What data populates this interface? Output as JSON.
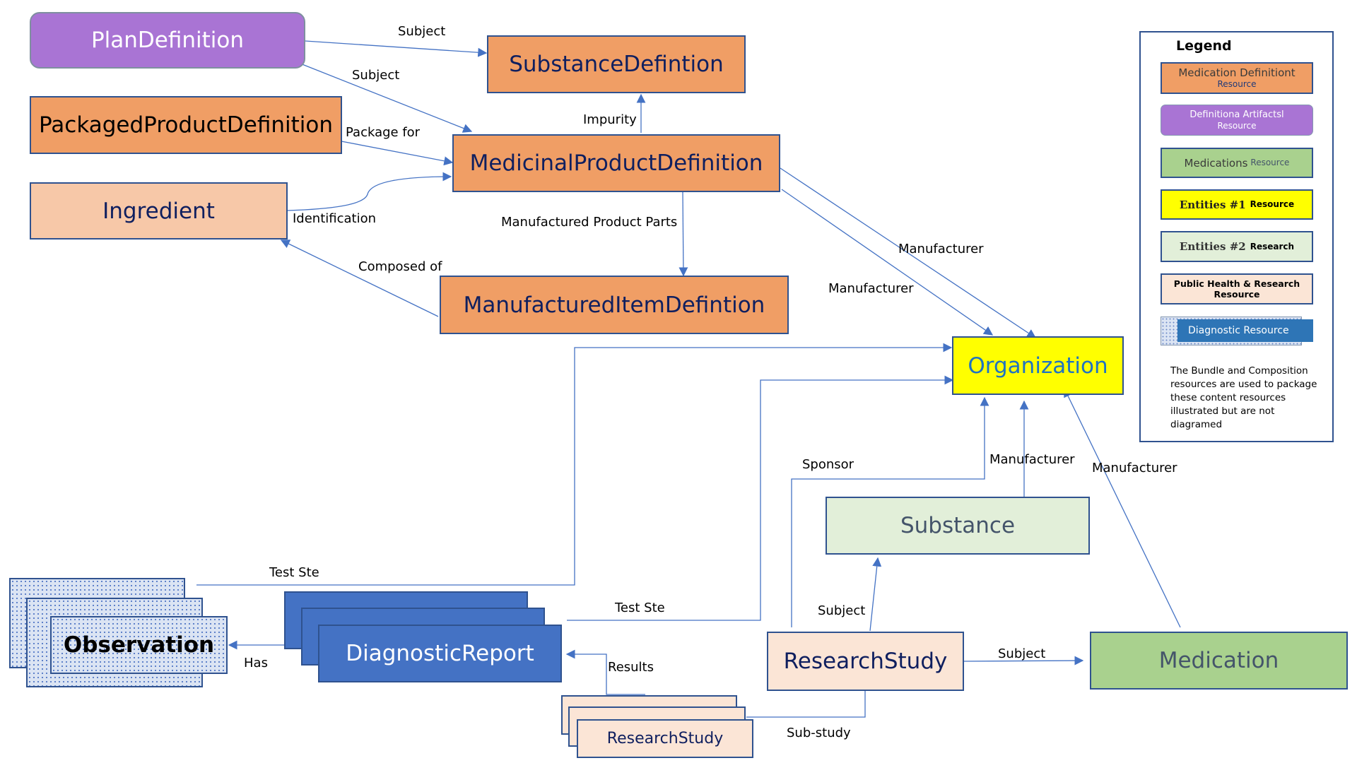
{
  "colors": {
    "connector": "#4472c4",
    "medication_definition": "#f09e65",
    "definitional_artifact": "#a974d4",
    "medications": "#a9d18e",
    "entities1": "#ffff00",
    "entities2": "#e2efd9",
    "public_health_research": "#fbe5d6",
    "diagnostic": "#4472c4"
  },
  "nodes": {
    "plan_definition": "PlanDefinition",
    "substance_definition": "SubstanceDefintion",
    "packaged_product_definition": "PackagedProductDefinition",
    "medicinal_product_definition": "MedicinalProductDefinition",
    "ingredient": "Ingredient",
    "manufactured_item_definition": "ManufacturedItemDefintion",
    "organization": "Organization",
    "substance": "Substance",
    "observation": "Observation",
    "diagnostic_report": "DiagnosticReport",
    "research_study": "ResearchStudy",
    "research_study_stack": "ResearchStudy",
    "medication": "Medication"
  },
  "edges": {
    "plan_to_substance_def": "Subject",
    "plan_to_mpd": "Subject",
    "package_for": "Package for",
    "identification": "Identification",
    "impurity": "Impurity",
    "manufactured_product_parts": "Manufactured Product Parts",
    "composed_of": "Composed of",
    "manufacturer_1": "Manufacturer",
    "manufacturer_2": "Manufacturer",
    "manufacturer_substance": "Manufacturer",
    "manufacturer_medication": "Manufacturer",
    "sponsor": "Sponsor",
    "test_site_observation": "Test Ste",
    "test_site_report": "Test Ste",
    "has": "Has",
    "results": "Results",
    "subject_substance": "Subject",
    "subject_medication": "Subject",
    "sub_study": "Sub-study"
  },
  "legend": {
    "title": "Legend",
    "items": [
      {
        "line1": "Medication Definitiont",
        "line2": "Resource"
      },
      {
        "line1": "Definitiona Artifactsl",
        "line2": "Resource"
      },
      {
        "line1": "Medications",
        "line2": "Resource"
      },
      {
        "line1": "Entities #1",
        "line2": "Resource"
      },
      {
        "line1": "Entities #2",
        "line2": "Research"
      },
      {
        "line1": "Public Health & Research",
        "line2": "Resource"
      },
      {
        "line1": "Diagnostic Resource",
        "line2": ""
      }
    ],
    "note": "The Bundle and Composition resources are used to package these content resources illustrated but are not diagramed"
  }
}
